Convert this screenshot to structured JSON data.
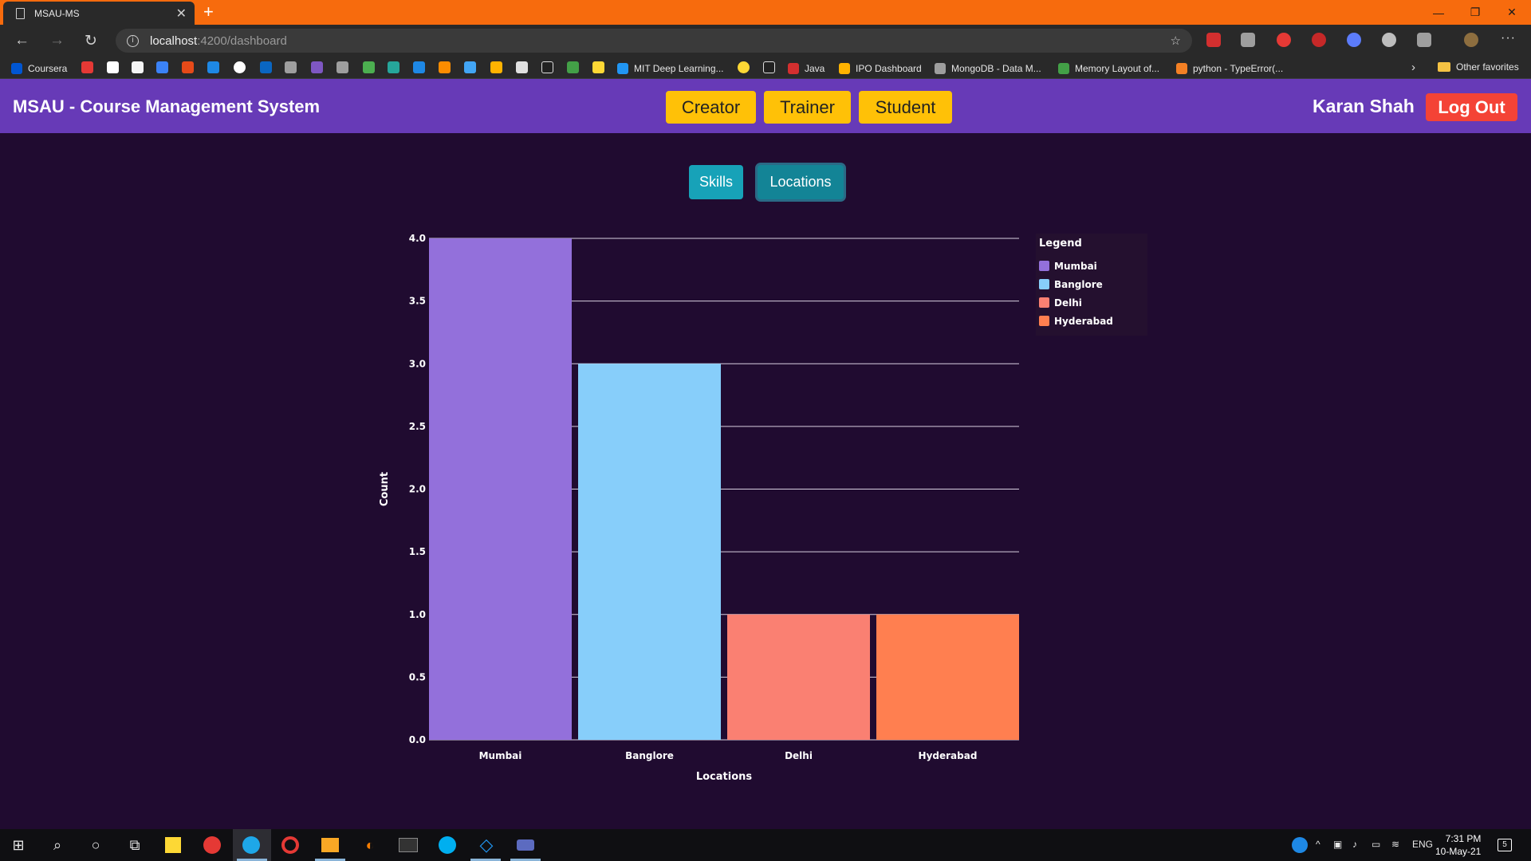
{
  "browser": {
    "tab_title": "MSAU-MS",
    "url_host": "localhost",
    "url_path": ":4200/dashboard",
    "bookmarks": [
      "Coursera",
      "MIT Deep Learning...",
      "Java",
      "IPO Dashboard",
      "MongoDB - Data M...",
      "Memory Layout of...",
      "python - TypeError(..."
    ],
    "other_favorites": "Other favorites"
  },
  "header": {
    "title": "MSAU - Course Management System",
    "roles": [
      "Creator",
      "Trainer",
      "Student"
    ],
    "user_name": "Karan Shah",
    "logout_label": "Log Out"
  },
  "toggles": {
    "skills_label": "Skills",
    "locations_label": "Locations",
    "active": "Locations"
  },
  "chart_data": {
    "type": "bar",
    "categories": [
      "Mumbai",
      "Banglore",
      "Delhi",
      "Hyderabad"
    ],
    "values": [
      4,
      3,
      1,
      1
    ],
    "colors": [
      "#9370db",
      "#87cefa",
      "#fa8072",
      "#ff7f50"
    ],
    "xlabel": "Locations",
    "ylabel": "Count",
    "ylim": [
      0,
      4
    ],
    "yticks": [
      "0.0",
      "0.5",
      "1.0",
      "1.5",
      "2.0",
      "2.5",
      "3.0",
      "3.5",
      "4.0"
    ],
    "legend_title": "Legend",
    "legend_position": "top-right",
    "grid": true
  },
  "taskbar": {
    "language": "ENG",
    "time": "7:31 PM",
    "date": "10-May-21",
    "notification_count": "5"
  }
}
